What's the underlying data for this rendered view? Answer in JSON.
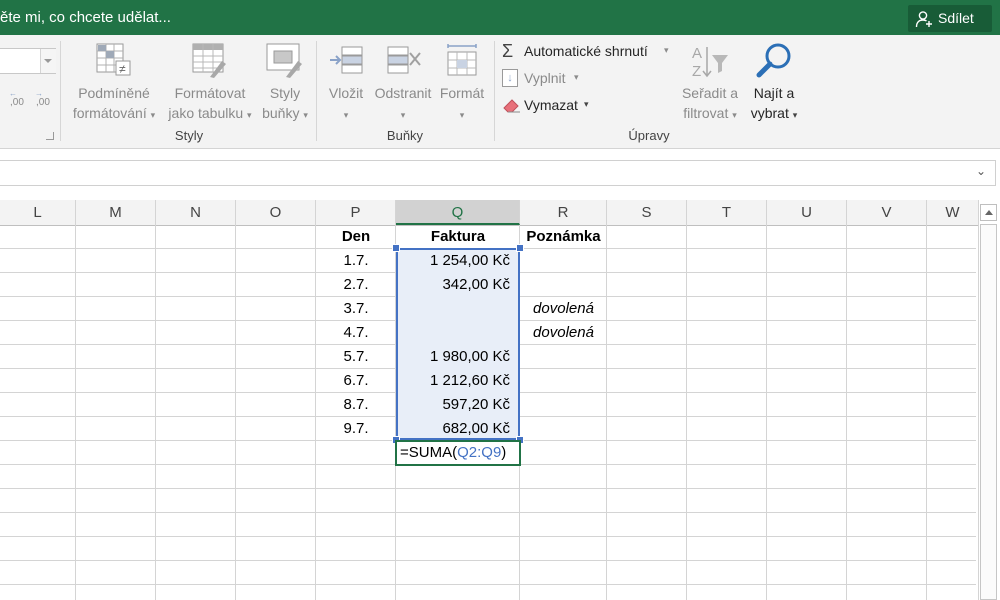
{
  "title_bar": {
    "tell_me": "ěte mi, co chcete udělat...",
    "share_label": "Sdílet"
  },
  "ribbon": {
    "number_format": {
      "increase_decimal": ",00",
      "decrease_decimal": ",00"
    },
    "styles": {
      "conditional_formatting": [
        "Podmíněné",
        "formátování"
      ],
      "format_as_table": [
        "Formátovat",
        "jako tabulku"
      ],
      "cell_styles": [
        "Styly",
        "buňky"
      ],
      "group_label": "Styly"
    },
    "cells": {
      "insert": "Vložit",
      "delete": "Odstranit",
      "format": "Formát",
      "group_label": "Buňky"
    },
    "editing": {
      "autosum": "Automatické shrnutí",
      "fill": "Vyplnit",
      "clear": "Vymazat",
      "sort_filter": [
        "Seřadit a",
        "filtrovat"
      ],
      "find_select": [
        "Najít a",
        "vybrat"
      ],
      "group_label": "Úpravy"
    }
  },
  "grid": {
    "columns": [
      "L",
      "M",
      "N",
      "O",
      "P",
      "Q",
      "R",
      "S",
      "T",
      "U",
      "V",
      "W"
    ],
    "selected_column": "Q",
    "headers": {
      "den": "Den",
      "faktura": "Faktura",
      "poznamka": "Poznámka"
    },
    "rows": [
      {
        "den": "1.7.",
        "faktura": "1 254,00 Kč",
        "poznamka": ""
      },
      {
        "den": "2.7.",
        "faktura": "342,00 Kč",
        "poznamka": ""
      },
      {
        "den": "3.7.",
        "faktura": "",
        "poznamka": "dovolená"
      },
      {
        "den": "4.7.",
        "faktura": "",
        "poznamka": "dovolená"
      },
      {
        "den": "5.7.",
        "faktura": "1 980,00 Kč",
        "poznamka": ""
      },
      {
        "den": "6.7.",
        "faktura": "1 212,60 Kč",
        "poznamka": ""
      },
      {
        "den": "8.7.",
        "faktura": "597,20 Kč",
        "poznamka": ""
      },
      {
        "den": "9.7.",
        "faktura": "682,00 Kč",
        "poznamka": ""
      }
    ],
    "formula": {
      "prefix": "=SUMA(",
      "range": "Q2:Q9",
      "suffix": ")"
    }
  },
  "colors": {
    "title_bar": "#217346",
    "range_highlight": "#4472c4",
    "active_cell_border": "#217346"
  }
}
